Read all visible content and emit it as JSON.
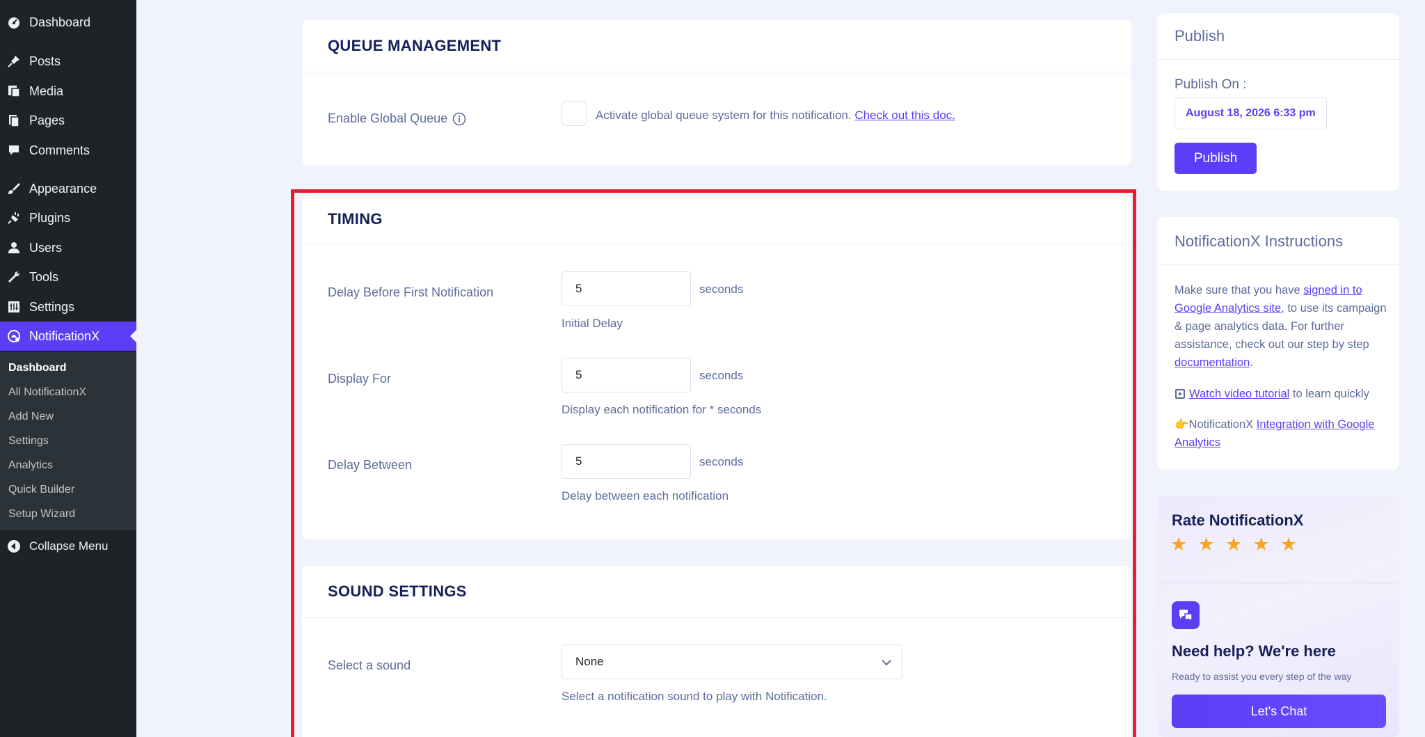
{
  "sidebar": {
    "menu": [
      {
        "label": "Dashboard",
        "icon": "dashboard-icon"
      },
      {
        "label": "Posts",
        "icon": "pin-icon"
      },
      {
        "label": "Media",
        "icon": "media-icon"
      },
      {
        "label": "Pages",
        "icon": "pages-icon"
      },
      {
        "label": "Comments",
        "icon": "comment-icon"
      },
      {
        "label": "Appearance",
        "icon": "brush-icon"
      },
      {
        "label": "Plugins",
        "icon": "plugin-icon"
      },
      {
        "label": "Users",
        "icon": "user-icon"
      },
      {
        "label": "Tools",
        "icon": "wrench-icon"
      },
      {
        "label": "Settings",
        "icon": "settings-icon"
      },
      {
        "label": "NotificationX",
        "icon": "notificationx-icon"
      }
    ],
    "submenu": [
      "Dashboard",
      "All NotificationX",
      "Add New",
      "Settings",
      "Analytics",
      "Quick Builder",
      "Setup Wizard"
    ],
    "collapse_label": "Collapse Menu"
  },
  "queue": {
    "title": "QUEUE MANAGEMENT",
    "enable_label": "Enable Global Queue",
    "checkbox_text": "Activate global queue system for this notification.",
    "doc_link": "Check out this doc."
  },
  "timing": {
    "title": "TIMING",
    "fields": [
      {
        "label": "Delay Before First Notification",
        "value": "5",
        "unit": "seconds",
        "hint": "Initial Delay"
      },
      {
        "label": "Display For",
        "value": "5",
        "unit": "seconds",
        "hint": "Display each notification for * seconds"
      },
      {
        "label": "Delay Between",
        "value": "5",
        "unit": "seconds",
        "hint": "Delay between each notification"
      }
    ]
  },
  "sound": {
    "title": "SOUND SETTINGS",
    "label": "Select a sound",
    "selected": "None",
    "hint": "Select a notification sound to play with Notification."
  },
  "publish": {
    "title": "Publish",
    "publish_on_label": "Publish On :",
    "date": "August 18, 2026 6:33 pm",
    "button": "Publish"
  },
  "instructions": {
    "title": "NotificationX Instructions",
    "p1_before": "Make sure that you have ",
    "p1_link": "signed in to Google Analytics site",
    "p1_after": ", to use its campaign & page analytics data. For further assistance, check out our step by step ",
    "p1_link2": "documentation",
    "p1_end": ".",
    "p2_link": "Watch video tutorial",
    "p2_after": " to learn quickly",
    "p3_before": "👉NotificationX ",
    "p3_link": "Integration with Google Analytics"
  },
  "rate": {
    "title": "Rate NotificationX",
    "stars": 5
  },
  "help": {
    "title": "Need help? We're here",
    "subtitle": "Ready to assist you every step of the way",
    "button": "Let's Chat"
  },
  "colors": {
    "accent": "#5b3ef5",
    "highlight": "#e41f2f",
    "sidebar": "#1d2327"
  }
}
